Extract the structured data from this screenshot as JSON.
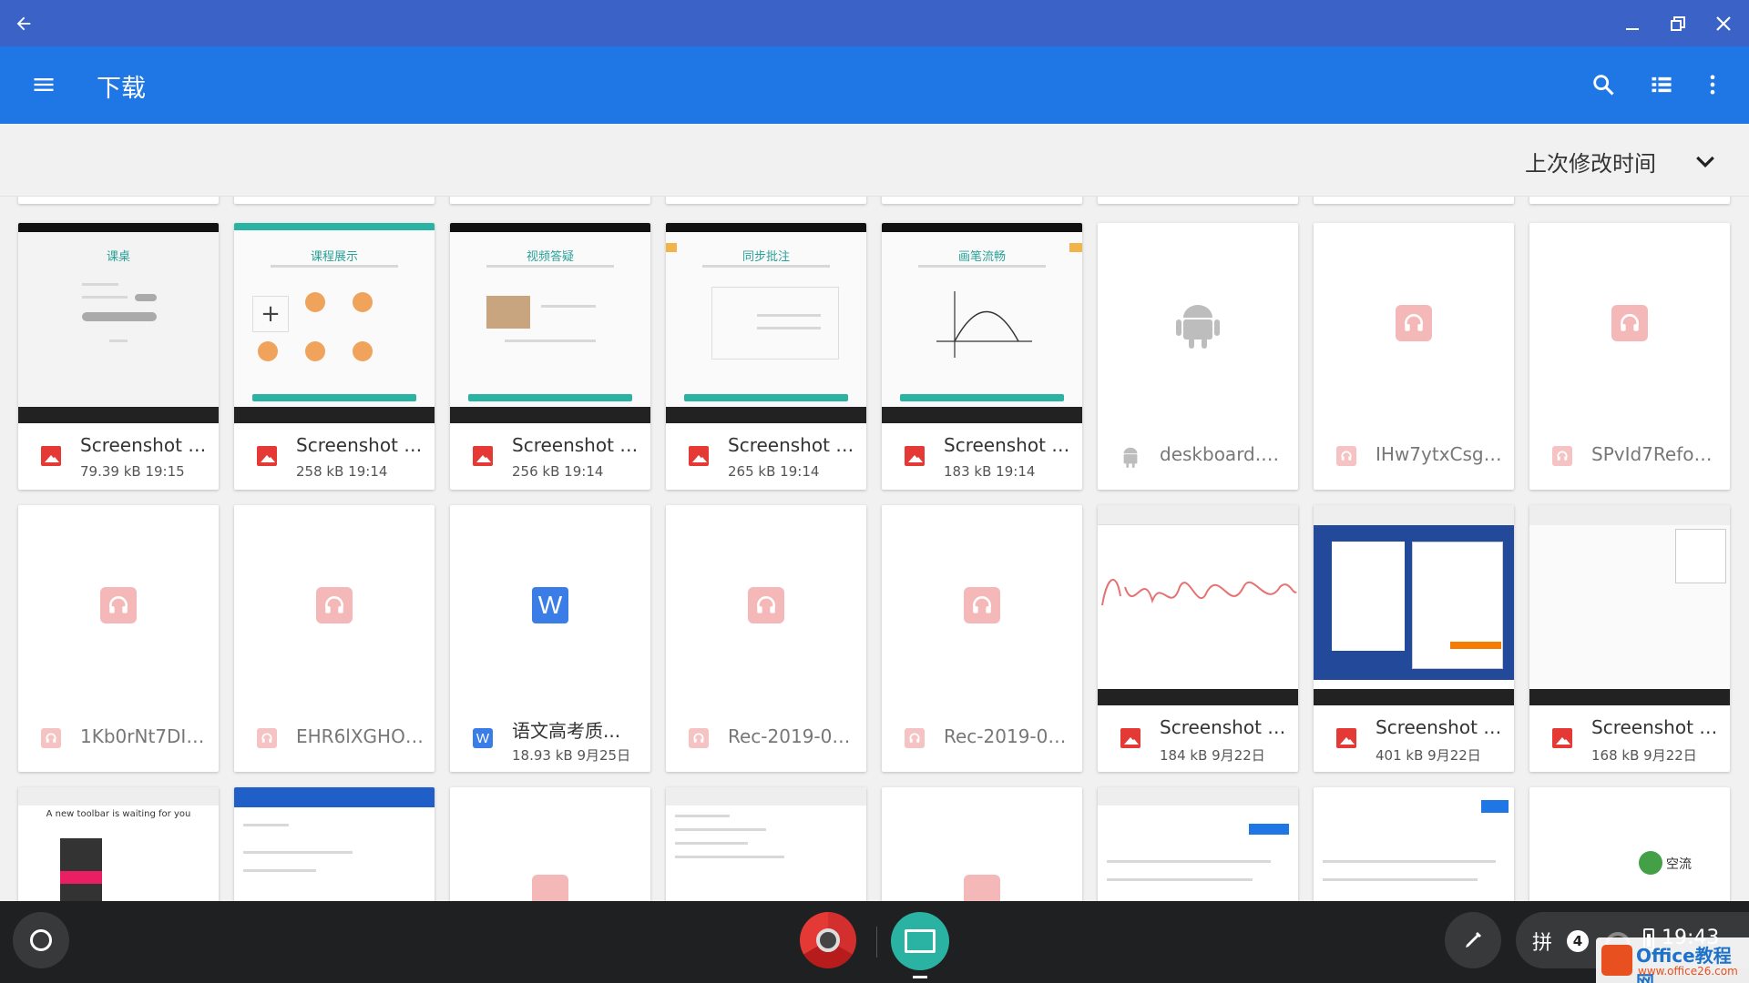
{
  "window": {
    "back_icon": "arrow-back-icon",
    "controls": [
      "minimize-icon",
      "restore-icon",
      "close-icon"
    ]
  },
  "toolbar": {
    "title": "下载",
    "menu_icon": "hamburger-menu-icon",
    "actions": [
      "search-icon",
      "list-view-icon",
      "more-vert-icon"
    ]
  },
  "sort": {
    "label": "上次修改时间",
    "icon": "chevron-down-icon"
  },
  "files": [
    {
      "name": "Screenshot 2...",
      "size": "79.39 kB",
      "time": "19:15",
      "type": "image",
      "thumb_title": "课桌"
    },
    {
      "name": "Screenshot 2...",
      "size": "258 kB",
      "time": "19:14",
      "type": "image",
      "thumb_title": "课程展示"
    },
    {
      "name": "Screenshot 2...",
      "size": "256 kB",
      "time": "19:14",
      "type": "image",
      "thumb_title": "视频答疑"
    },
    {
      "name": "Screenshot 2...",
      "size": "265 kB",
      "time": "19:14",
      "type": "image",
      "thumb_title": "同步批注"
    },
    {
      "name": "Screenshot 2...",
      "size": "183 kB",
      "time": "19:14",
      "type": "image",
      "thumb_title": "画笔流畅"
    },
    {
      "name": "deskboard.a...",
      "size": "",
      "time": "",
      "type": "apk",
      "thumb_title": ""
    },
    {
      "name": "IHw7ytxCsgI...",
      "size": "",
      "time": "",
      "type": "audio",
      "thumb_title": ""
    },
    {
      "name": "SPvId7Refo4...",
      "size": "",
      "time": "",
      "type": "audio",
      "thumb_title": ""
    },
    {
      "name": "1Kb0rNt7DI4...",
      "size": "",
      "time": "",
      "type": "audio",
      "thumb_title": ""
    },
    {
      "name": "EHR6lXGHO_...",
      "size": "",
      "time": "",
      "type": "audio",
      "thumb_title": ""
    },
    {
      "name": "语文高考质...",
      "size": "18.93 kB",
      "time": "9月25日",
      "type": "word",
      "thumb_title": ""
    },
    {
      "name": "Rec-2019-09...",
      "size": "",
      "time": "",
      "type": "audio",
      "thumb_title": ""
    },
    {
      "name": "Rec-2019-09...",
      "size": "",
      "time": "",
      "type": "audio",
      "thumb_title": ""
    },
    {
      "name": "Screenshot 2...",
      "size": "184 kB",
      "time": "9月22日",
      "type": "image",
      "thumb_title": ""
    },
    {
      "name": "Screenshot 2...",
      "size": "401 kB",
      "time": "9月22日",
      "type": "image",
      "thumb_title": ""
    },
    {
      "name": "Screenshot 2...",
      "size": "168 kB",
      "time": "9月22日",
      "type": "image",
      "thumb_title": ""
    }
  ],
  "partial_row_texts": {
    "toolbar_wait": "A new toolbar is waiting for you",
    "chat_label": "空流"
  },
  "shelf": {
    "launcher_icon": "launcher-circle-icon",
    "apps": [
      "chrome-app-icon",
      "deskboard-app-icon"
    ],
    "pen_icon": "stylus-pen-icon",
    "ime": "拼",
    "notification_count": "4",
    "time": "19:43"
  },
  "watermark": {
    "line1": "Office教程网",
    "line2": "www.office26.com"
  },
  "colors": {
    "titlebar": "#3b63c7",
    "appbar": "#1f77e5",
    "image_icon": "#e53935",
    "audio_icon": "#f5b8b8",
    "word_icon": "#3b7de6",
    "thumb_accent": "#2ab3a3"
  }
}
